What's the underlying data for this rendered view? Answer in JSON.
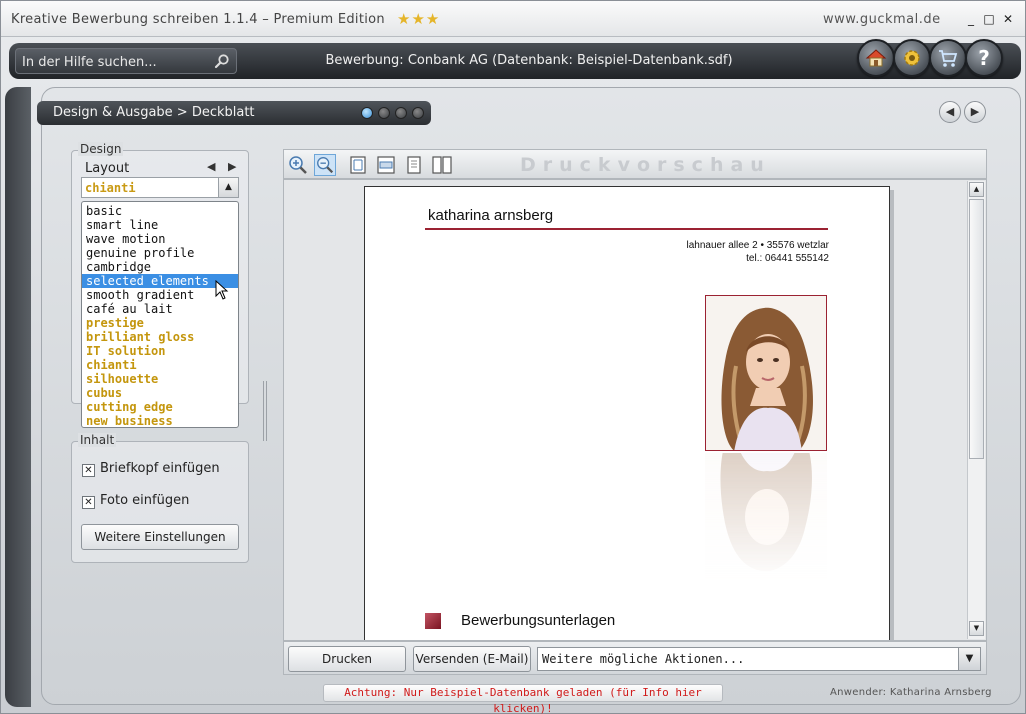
{
  "window": {
    "title": "Kreative Bewerbung schreiben 1.1.4  –  Premium Edition",
    "stars": "★★★",
    "url": "www.guckmal.de",
    "minimize": "_",
    "maximize": "□",
    "close": "✕"
  },
  "toolbar": {
    "search_placeholder": "In der Hilfe suchen...",
    "title": "Bewerbung: Conbank AG (Datenbank: Beispiel-Datenbank.sdf)",
    "buttons": [
      "home-icon",
      "settings-icon",
      "cart-icon",
      "help-icon"
    ]
  },
  "breadcrumb": "Design & Ausgabe > Deckblatt",
  "nav": {
    "prev": "◀",
    "next": "▶"
  },
  "design": {
    "group_label": "Design",
    "layout_label": "Layout",
    "layout_prev": "◀",
    "layout_next": "▶",
    "combo_value": "chianti",
    "combo_arrow": "▲",
    "layouts": [
      {
        "label": "basic",
        "premium": false
      },
      {
        "label": "smart line",
        "premium": false
      },
      {
        "label": "wave motion",
        "premium": false
      },
      {
        "label": "genuine profile",
        "premium": false
      },
      {
        "label": "cambridge",
        "premium": false
      },
      {
        "label": "selected elements",
        "premium": false,
        "selected": true
      },
      {
        "label": "smooth gradient",
        "premium": false
      },
      {
        "label": "café au lait",
        "premium": false
      },
      {
        "label": "prestige",
        "premium": true
      },
      {
        "label": "brilliant gloss",
        "premium": true
      },
      {
        "label": "IT solution",
        "premium": true
      },
      {
        "label": "chianti",
        "premium": true
      },
      {
        "label": "silhouette",
        "premium": true
      },
      {
        "label": "cubus",
        "premium": true
      },
      {
        "label": "cutting edge",
        "premium": true
      },
      {
        "label": "new business",
        "premium": true
      }
    ]
  },
  "inhalt": {
    "group_label": "Inhalt",
    "briefkopf_label": "Briefkopf einfügen",
    "foto_label": "Foto einfügen",
    "check_mark": "✕",
    "more_settings": "Weitere Einstellungen"
  },
  "preview": {
    "title": "Druckvorschau",
    "tools": [
      "zoom-in-icon",
      "zoom-out-icon",
      "fit-page-icon",
      "fit-width-icon",
      "single-page-icon",
      "two-pages-icon"
    ],
    "name": "katharina arnsberg",
    "address_line1": "lahnauer allee 2  •  35576 wetzlar",
    "address_line2": "tel.: 06441 555142",
    "section": "Bewerbungsunterlagen",
    "scroll_up": "▲",
    "scroll_down": "▼"
  },
  "actions": {
    "print": "Drucken",
    "send": "Versenden (E-Mail)",
    "more_actions": "Weitere mögliche Aktionen...",
    "dropdown_arrow": "▼"
  },
  "footer": {
    "warning": "Achtung: Nur Beispiel-Datenbank geladen (für Info hier klicken)!",
    "user": "Anwender: Katharina Arnsberg"
  },
  "colors": {
    "accent": "#9b2232",
    "premium": "#c4960d",
    "selection": "#3b8fe4",
    "warning": "#d01a1a"
  }
}
